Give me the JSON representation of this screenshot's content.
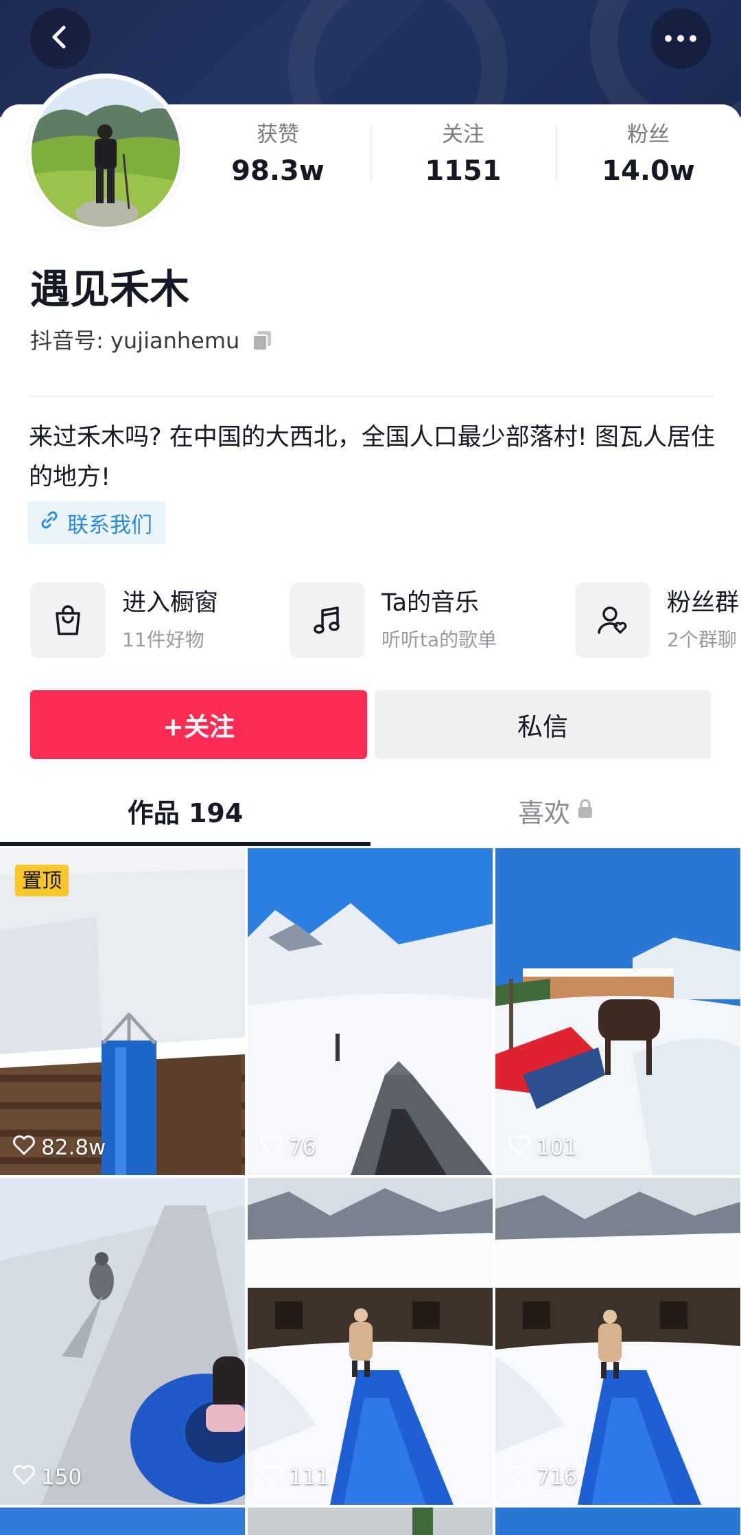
{
  "header": {
    "back_icon": "chevron-left-icon",
    "more_icon": "more-horizontal-icon"
  },
  "profile": {
    "name": "遇见禾木",
    "douyin_id": "抖音号: yujianhemu",
    "bio": "来过禾木吗? 在中国的大西北，全国人口最少部落村! 图瓦人居住的地方!",
    "contact_label": "联系我们"
  },
  "stats": [
    {
      "label": "获赞",
      "value": "98.3w"
    },
    {
      "label": "关注",
      "value": "1151"
    },
    {
      "label": "粉丝",
      "value": "14.0w"
    }
  ],
  "entries": [
    {
      "title": "进入橱窗",
      "subtitle": "11件好物",
      "icon": "shopping-bag-icon"
    },
    {
      "title": "Ta的音乐",
      "subtitle": "听听ta的歌单",
      "icon": "music-note-icon"
    },
    {
      "title": "粉丝群",
      "subtitle": "2个群聊",
      "icon": "fan-group-icon"
    }
  ],
  "actions": {
    "follow_label": "+关注",
    "message_label": "私信"
  },
  "tabs": {
    "works_label": "作品 194",
    "likes_label": "喜欢"
  },
  "videos": [
    {
      "likes": "82.8w",
      "pinned_label": "置顶"
    },
    {
      "likes": "76"
    },
    {
      "likes": "101"
    },
    {
      "likes": "150"
    },
    {
      "likes": "111"
    },
    {
      "likes": "716"
    }
  ],
  "colors": {
    "accent": "#fe2c55",
    "banner": "#1d2a52",
    "link": "#2c8ad8",
    "pin_badge": "#f8c72a"
  }
}
